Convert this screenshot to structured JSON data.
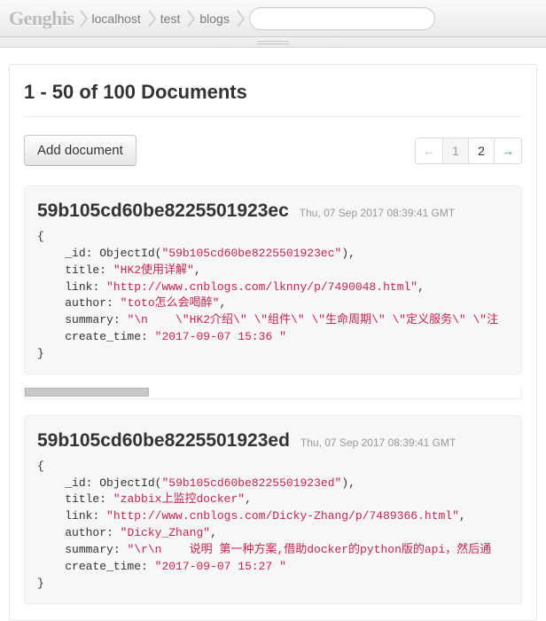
{
  "brand": "Genghis",
  "breadcrumbs": [
    "localhost",
    "test",
    "blogs"
  ],
  "search": {
    "placeholder": ""
  },
  "heading": "1 - 50 of 100 Documents",
  "toolbar": {
    "add_label": "Add document"
  },
  "pager": {
    "prev": "←",
    "next": "→",
    "pages": [
      "1",
      "2"
    ],
    "active_index": 0
  },
  "documents": [
    {
      "id": "59b105cd60be8225501923ec",
      "date": "Thu, 07 Sep 2017 08:39:41 GMT",
      "fields": {
        "_id_func": "ObjectId",
        "_id_arg": "\"59b105cd60be8225501923ec\"",
        "title": "\"HK2使用详解\"",
        "link": "\"http://www.cnblogs.com/lknny/p/7490048.html\"",
        "author": "\"toto怎么会喝醉\"",
        "summary": "\"\\n    \\\"HK2介绍\\\" \\\"组件\\\" \\\"生命周期\\\" \\\"定义服务\\\" \\\"注",
        "create_time": "\"2017-09-07 15:36 \""
      }
    },
    {
      "id": "59b105cd60be8225501923ed",
      "date": "Thu, 07 Sep 2017 08:39:41 GMT",
      "fields": {
        "_id_func": "ObjectId",
        "_id_arg": "\"59b105cd60be8225501923ed\"",
        "title": "\"zabbix上监控docker\"",
        "link": "\"http://www.cnblogs.com/Dicky-Zhang/p/7489366.html\"",
        "author": "\"Dicky_Zhang\"",
        "summary": "\"\\r\\n    说明 第一种方案,借助docker的python版的api，然后通",
        "create_time": "\"2017-09-07 15:27 \""
      }
    }
  ]
}
